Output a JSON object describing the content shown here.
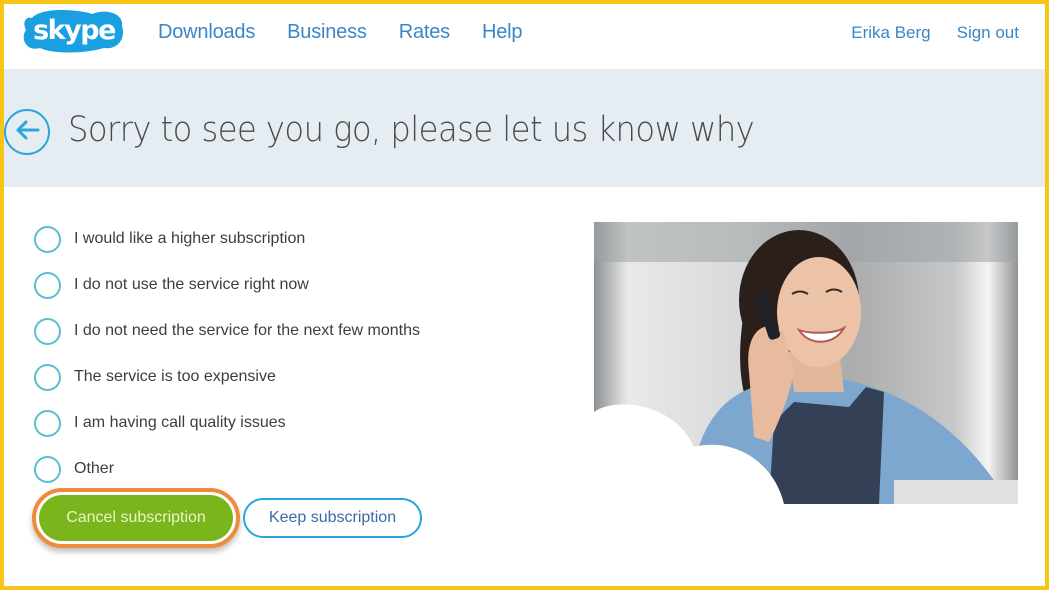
{
  "header": {
    "logo_text": "skype",
    "nav": [
      {
        "label": "Downloads"
      },
      {
        "label": "Business"
      },
      {
        "label": "Rates"
      },
      {
        "label": "Help"
      }
    ],
    "user_name": "Erika Berg",
    "sign_out": "Sign out"
  },
  "banner": {
    "back_icon": "arrow-left-circle-icon",
    "title": "Sorry to see you go, please let us know why"
  },
  "reasons": [
    {
      "label": "I would like a higher subscription",
      "selected": false
    },
    {
      "label": "I do not use the service right now",
      "selected": false
    },
    {
      "label": "I do not need the service for the next few months",
      "selected": false
    },
    {
      "label": "The service is too expensive",
      "selected": false
    },
    {
      "label": "I am having call quality issues",
      "selected": false
    },
    {
      "label": "Other",
      "selected": false
    }
  ],
  "actions": {
    "cancel_label": "Cancel subscription",
    "keep_label": "Keep subscription"
  },
  "photo": {
    "description": "Woman smiling while talking on a mobile phone"
  },
  "colors": {
    "brand_blue": "#00aff0",
    "link_blue": "#3b86c4",
    "cancel_green": "#7ab51d",
    "highlight_orange": "#f08a3c",
    "frame_yellow": "#f7c518",
    "banner_bg": "#e5edf3"
  }
}
